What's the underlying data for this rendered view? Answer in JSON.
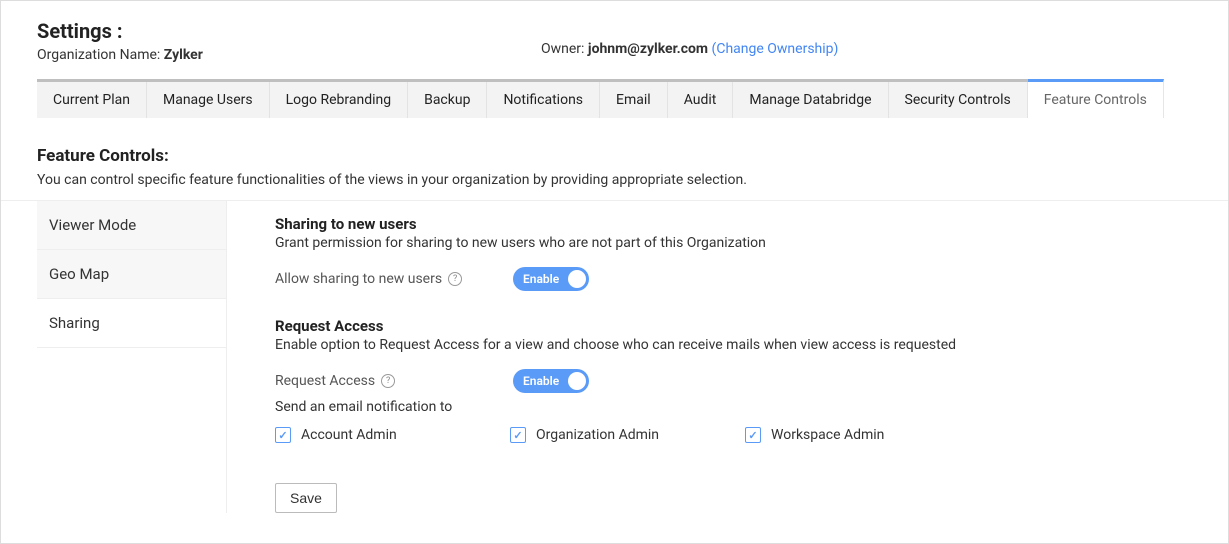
{
  "header": {
    "page_title": "Settings :",
    "org_label": "Organization Name: ",
    "org_name": "Zylker",
    "owner_label": "Owner: ",
    "owner_email": "johnm@zylker.com",
    "change_ownership": "(Change Ownership)"
  },
  "tabs": [
    "Current Plan",
    "Manage Users",
    "Logo Rebranding",
    "Backup",
    "Notifications",
    "Email",
    "Audit",
    "Manage Databridge",
    "Security Controls",
    "Feature Controls"
  ],
  "active_tab_index": 9,
  "section": {
    "heading": "Feature Controls:",
    "description": "You can control specific feature functionalities of the views in your organization by providing appropriate selection."
  },
  "side_items": [
    "Viewer Mode",
    "Geo Map",
    "Sharing"
  ],
  "active_side_index": 2,
  "sharing_block": {
    "title": "Sharing to new users",
    "desc": "Grant permission for sharing to new users who are not part of this Organization",
    "setting_label": "Allow sharing to new users",
    "toggle_text": "Enable"
  },
  "request_block": {
    "title": "Request Access",
    "desc": "Enable option to Request Access for a view and choose who can receive mails when view access is requested",
    "setting_label": "Request Access",
    "toggle_text": "Enable",
    "notif_label": "Send an email notification to",
    "recipients": [
      "Account Admin",
      "Organization Admin",
      "Workspace Admin"
    ]
  },
  "save_label": "Save"
}
